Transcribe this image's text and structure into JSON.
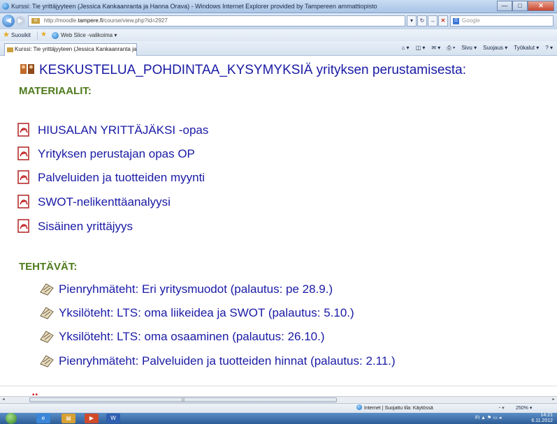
{
  "window": {
    "title": "Kurssi: Tie yrittäjyyteen (Jessica Kankaanranta ja Hanna Orava) - Windows Internet Explorer provided by Tampereen ammattiopisto",
    "min": "—",
    "max": "□",
    "close": "✕"
  },
  "address": {
    "url_prefix": "http://moodle.",
    "url_host": "tampere.fi",
    "url_path": "/course/view.php?id=2927",
    "site_badge": "m",
    "refresh": "↻",
    "go": "→",
    "stop": "✕",
    "search_placeholder": "Google"
  },
  "favorites": {
    "label": "Suosikit",
    "webslice": "Web Slice -valikoima ▾"
  },
  "tab": {
    "label": "Kurssi: Tie yrittäjyyteen (Jessica Kankaanranta ja ..."
  },
  "commands": {
    "home": "⌂ ▾",
    "feeds": "◫ ▾",
    "mail": "✉ ▾",
    "print": "⎙ ▾",
    "page": "Sivu ▾",
    "safety": "Suojaus ▾",
    "tools": "Työkalut ▾",
    "help": "? ▾"
  },
  "content": {
    "heading": "KESKUSTELUA_POHDINTAA_KYSYMYKSIÄ yrityksen perustamisesta:",
    "materials_title": "MATERIAALIT:",
    "materials": [
      "HIUSALAN YRITTÄJÄKSI -opas",
      "Yrityksen perustajan opas OP",
      "Palveluiden ja tuotteiden myynti",
      "SWOT-nelikenttäanalyysi",
      "Sisäinen yrittäjyys"
    ],
    "tasks_title": "TEHTÄVÄT:",
    "tasks": [
      "Pienryhmäteht: Eri yritysmuodot (palautus: pe 28.9.)",
      "Yksilöteht: LTS: oma liikeidea ja SWOT (palautus: 5.10.)",
      "Yksilöteht: LTS: oma osaaminen (palautus: 26.10.)",
      "Pienryhmäteht: Palveluiden ja tuotteiden hinnat (palautus: 2.11.)"
    ],
    "dots": "••"
  },
  "scrollbar": {
    "left": "◂",
    "right": "▸",
    "grip": "|||"
  },
  "status": {
    "zone": "Internet | Suojattu tila: Käytössä",
    "controls": "◔ ▾",
    "zoom": "250% ▾"
  },
  "taskbar": {
    "apps": [
      "e",
      "▤",
      "▶",
      "W"
    ],
    "tray_icons": "FI  ▲  ⚑  ▭  ◂",
    "time": "14:21",
    "date": "6.11.2012"
  },
  "colors": {
    "link": "#1a1aa6",
    "section": "#4e7a1c"
  }
}
